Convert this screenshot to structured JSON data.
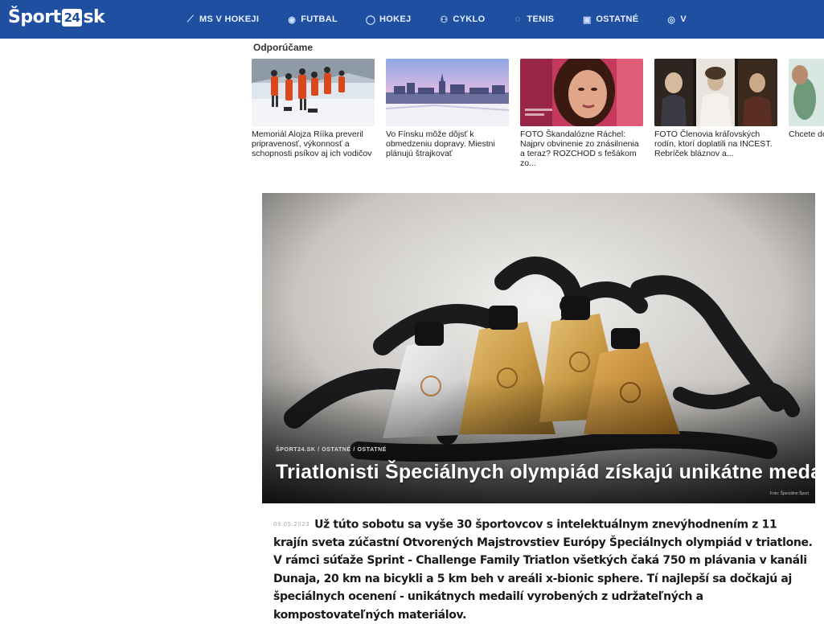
{
  "header": {
    "logo_prefix": "Šport",
    "logo_badge": "24",
    "logo_suffix": "sk",
    "nav": [
      {
        "label": "MS V HOKEJI",
        "icon": "hockey-icon",
        "glyph": "🏒"
      },
      {
        "label": "FUTBAL",
        "icon": "football-icon",
        "glyph": "⚽"
      },
      {
        "label": "HOKEJ",
        "icon": "puck-icon",
        "glyph": "◯"
      },
      {
        "label": "CYKLO",
        "icon": "bicycle-icon",
        "glyph": "🚲"
      },
      {
        "label": "TENIS",
        "icon": "tennis-icon",
        "glyph": "◌"
      },
      {
        "label": "OSTATNÉ",
        "icon": "other-sports-icon",
        "glyph": "▣"
      },
      {
        "label": "V",
        "icon": "more-icon",
        "glyph": "◎"
      }
    ],
    "colors": {
      "bar": "#1f4fa1"
    }
  },
  "recommended": {
    "title": "Odporúčame",
    "items": [
      {
        "title": "Memoriál Alojza Rííka preveril pripravenosť, výkonnosť a schopnosti psíkov aj ich vodičov"
      },
      {
        "title": "Vo Fínsku môže dôjsť k obmedzeniu dopravy. Miestni plánujú štrajkovať"
      },
      {
        "title": "FOTO Škandalózne Ráchel: Najprv obvinenie zo znásilnenia a teraz? ROZCHOD s fešákom zo..."
      },
      {
        "title": "FOTO Členovia kráľovských rodín, ktorí doplatili na INCEST. Rebríček bláznov a..."
      },
      {
        "title": "Chcete do strav pôjde to"
      }
    ]
  },
  "hero": {
    "breadcrumb": "ŠPORT24.SK / OSTATNÉ / OSTATNÉ",
    "title": "Triatlonisti Špeciálnych olympiád získajú unikátne medaily",
    "credit": "Foto: Špeciálne Šport"
  },
  "article": {
    "date": "09.05.2023",
    "lead": "Už túto sobotu sa vyše 30 športovcov s intelektuálnym znevýhodnením z 11 krajín sveta zúčastní Otvorených Majstrovstiev Európy Špeciálnych olympiád v triatlone. V rámci súťaže Sprint - Challenge Family Triatlon všetkých čaká 750 m plávania v kanáli Dunaja, 20 km na bicykli a 5 km beh v areáli x-bionic sphere. Tí najlepší sa dočkajú aj špeciálnych ocenení - unikátnych medailí vyrobených z udržateľných a kompostovateľných materiálov."
  }
}
